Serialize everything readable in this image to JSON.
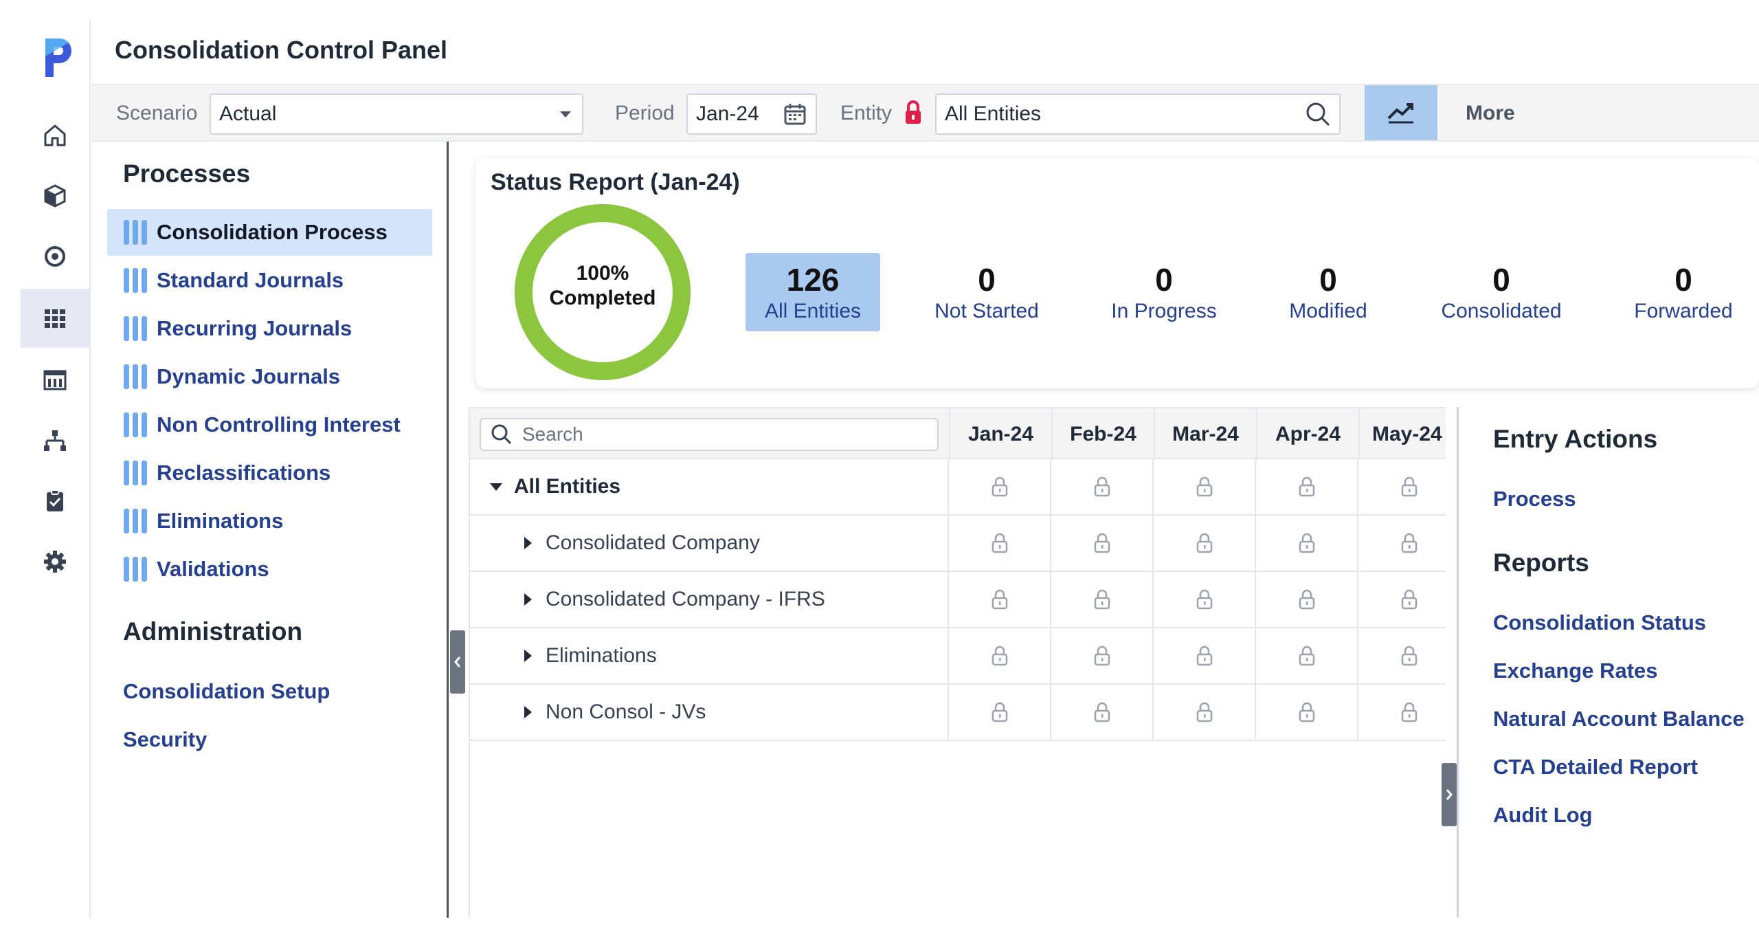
{
  "app": {
    "title": "Consolidation Control Panel"
  },
  "rail": {
    "items": [
      {
        "icon": "home-icon"
      },
      {
        "icon": "cube-icon"
      },
      {
        "icon": "target-icon"
      },
      {
        "icon": "grid-icon",
        "active": true
      },
      {
        "icon": "report-icon"
      },
      {
        "icon": "hierarchy-icon"
      },
      {
        "icon": "clipboard-check-icon"
      },
      {
        "icon": "gear-icon"
      }
    ]
  },
  "toolbar": {
    "scenario_label": "Scenario",
    "scenario_value": "Actual",
    "period_label": "Period",
    "period_value": "Jan-24",
    "entity_label": "Entity",
    "entity_value": "All Entities",
    "more_label": "More"
  },
  "leftnav": {
    "processes_title": "Processes",
    "processes": [
      {
        "label": "Consolidation Process",
        "active": true
      },
      {
        "label": "Standard Journals"
      },
      {
        "label": "Recurring Journals"
      },
      {
        "label": "Dynamic Journals"
      },
      {
        "label": "Non Controlling Interest"
      },
      {
        "label": "Reclassifications"
      },
      {
        "label": "Eliminations"
      },
      {
        "label": "Validations"
      }
    ],
    "admin_title": "Administration",
    "admin": [
      {
        "label": "Consolidation Setup"
      },
      {
        "label": "Security"
      }
    ]
  },
  "status": {
    "title": "Status Report (Jan-24)",
    "completion_pct": "100%",
    "completion_label": "Completed",
    "completion_fraction": 1.0,
    "stats": [
      {
        "num": "126",
        "label": "All Entities",
        "active": true
      },
      {
        "num": "0",
        "label": "Not Started"
      },
      {
        "num": "0",
        "label": "In Progress"
      },
      {
        "num": "0",
        "label": "Modified"
      },
      {
        "num": "0",
        "label": "Consolidated"
      },
      {
        "num": "0",
        "label": "Forwarded"
      }
    ],
    "ring_color": "#8cc63f"
  },
  "grid": {
    "search_placeholder": "Search",
    "columns": [
      "Jan-24",
      "Feb-24",
      "Mar-24",
      "Apr-24",
      "May-24"
    ],
    "rows": [
      {
        "name": "All Entities",
        "expanded": true,
        "level": 0
      },
      {
        "name": "Consolidated Company",
        "expanded": false,
        "level": 1
      },
      {
        "name": "Consolidated Company - IFRS",
        "expanded": false,
        "level": 1
      },
      {
        "name": "Eliminations",
        "expanded": false,
        "level": 1
      },
      {
        "name": "Non Consol - JVs",
        "expanded": false,
        "level": 1
      }
    ]
  },
  "rightpanel": {
    "entry_title": "Entry Actions",
    "entry_links": [
      "Process"
    ],
    "reports_title": "Reports",
    "reports_links": [
      "Consolidation Status",
      "Exchange Rates",
      "Natural Account Balance",
      "CTA Detailed Report",
      "Audit Log"
    ]
  }
}
